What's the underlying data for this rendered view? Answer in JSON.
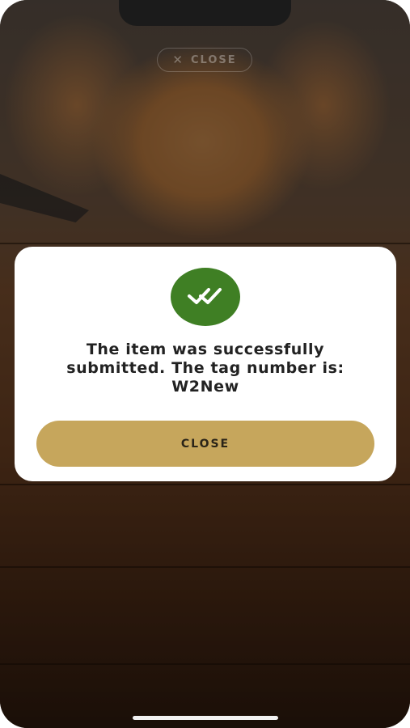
{
  "overlay": {
    "close_label": "CLOSE",
    "close_icon": "close-icon"
  },
  "dialog": {
    "icon": "double-check-icon",
    "icon_color": "#3f7f24",
    "message_line1": "The item was successfully",
    "message_line2": "submitted. The tag number is:",
    "message_line3": "W2New",
    "button_label": "CLOSE",
    "button_color": "#c6a65c"
  }
}
